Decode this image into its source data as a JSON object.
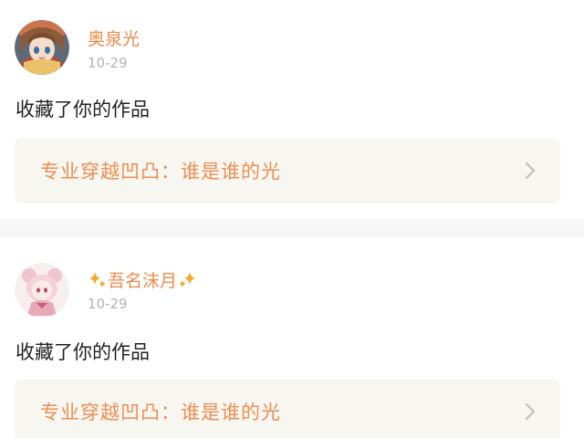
{
  "posts": [
    {
      "username": "奥泉光",
      "time": "10-29",
      "action": "收藏了你的作品",
      "work_title": "专业穿越凹凸：谁是谁的光"
    },
    {
      "username": "吾名沫月",
      "time": "10-29",
      "action": "收藏了你的作品",
      "work_title": "专业穿越凹凸：谁是谁的光"
    }
  ],
  "colors": {
    "username": "#f08a4b",
    "work_title": "#ee8e52",
    "card_bg": "#f7f6f1",
    "timestamp": "#b3b3b3",
    "divider": "#f6f6f6"
  },
  "icons": {
    "avatar_1": "anime-girl-avatar",
    "avatar_2": "pink-anime-girl-avatar",
    "decoration": "sparkle-icon",
    "arrow": "chevron-right-icon"
  }
}
